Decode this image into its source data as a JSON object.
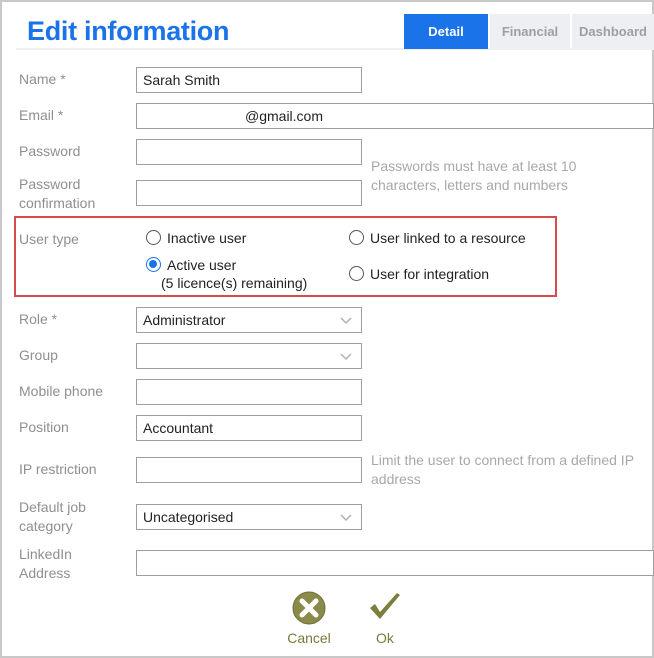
{
  "header": {
    "title": "Edit information"
  },
  "tabs": [
    {
      "label": "Detail",
      "active": true
    },
    {
      "label": "Financial",
      "active": false
    },
    {
      "label": "Dashboard",
      "active": false
    }
  ],
  "form": {
    "name": {
      "label": "Name *",
      "value": "Sarah Smith"
    },
    "email": {
      "label": "Email *",
      "value": "@gmail.com"
    },
    "password": {
      "label": "Password",
      "value": ""
    },
    "password_confirmation": {
      "label_line1": "Password",
      "label_line2": "confirmation",
      "value": ""
    },
    "password_hint_line1": "Passwords must have at least 10",
    "password_hint_line2": "characters, letters and numbers",
    "user_type": {
      "label": "User type",
      "options": {
        "inactive": {
          "label": "Inactive user",
          "checked": false
        },
        "active": {
          "label": "Active user",
          "sub": "(5 licence(s) remaining)",
          "checked": true
        },
        "linked": {
          "label": "User linked to a resource",
          "checked": false
        },
        "integration": {
          "label": "User for integration",
          "checked": false
        }
      }
    },
    "role": {
      "label": "Role *",
      "value": "Administrator"
    },
    "group": {
      "label": "Group",
      "value": ""
    },
    "mobile_phone": {
      "label": "Mobile phone",
      "value": ""
    },
    "position": {
      "label": "Position",
      "value": "Accountant"
    },
    "ip_restriction": {
      "label": "IP restriction",
      "value": ""
    },
    "ip_hint_line1": "Limit the user to connect from a defined IP",
    "ip_hint_line2": "address",
    "default_job_category": {
      "label_line1": "Default job",
      "label_line2": "category",
      "value": "Uncategorised"
    },
    "linkedin": {
      "label_line1": "LinkedIn",
      "label_line2": "Address",
      "value": ""
    }
  },
  "actions": {
    "cancel": {
      "label": "Cancel",
      "icon": "cancel-x-icon"
    },
    "ok": {
      "label": "Ok",
      "icon": "checkmark-icon"
    }
  },
  "colors": {
    "accent": "#1a73e8",
    "highlight_border": "#d94a4a",
    "action_olive": "#7a7a3a"
  }
}
